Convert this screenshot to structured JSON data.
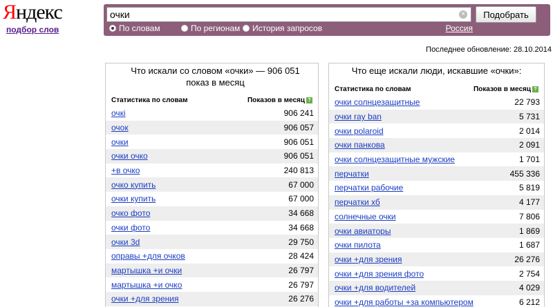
{
  "logo": {
    "brand_first": "Я",
    "brand_rest": "ндекс",
    "sub": "подбор слов"
  },
  "search": {
    "value": "очки",
    "clear_glyph": "×",
    "submit_label": "Подобрать",
    "modes": [
      "По словам",
      "По регионам",
      "История запросов"
    ],
    "active_mode": 0,
    "region": "Россия"
  },
  "updated": "Последнее обновление: 28.10.2014",
  "left": {
    "title": "Что искали со словом «очки» — 906 051 показ в месяц",
    "col_words": "Статистика по словам",
    "col_shows": "Показов в месяц",
    "help": "?",
    "rows": [
      {
        "kw": "очкі",
        "count": "906 241"
      },
      {
        "kw": "очок",
        "count": "906 057"
      },
      {
        "kw": "очки",
        "count": "906 051"
      },
      {
        "kw": "очки очко",
        "count": "906 051"
      },
      {
        "kw": "+в очко",
        "count": "240 813"
      },
      {
        "kw": "очко купить",
        "count": "67 000"
      },
      {
        "kw": "очки купить",
        "count": "67 000"
      },
      {
        "kw": "очко фото",
        "count": "34 668"
      },
      {
        "kw": "очки фото",
        "count": "34 668"
      },
      {
        "kw": "очки 3d",
        "count": "29 750"
      },
      {
        "kw": "оправы +для очков",
        "count": "28 424"
      },
      {
        "kw": "мартышка +и очки",
        "count": "26 797"
      },
      {
        "kw": "мартышка +и очко",
        "count": "26 797"
      },
      {
        "kw": "очки +для зрения",
        "count": "26 276"
      }
    ]
  },
  "right": {
    "title": "Что еще искали люди, искавшие «очки»:",
    "col_words": "Статистика по словам",
    "col_shows": "Показов в месяц",
    "help": "?",
    "rows": [
      {
        "kw": "очки солнцезащитные",
        "count": "22 793"
      },
      {
        "kw": "очки ray ban",
        "count": "5 731"
      },
      {
        "kw": "очки polaroid",
        "count": "2 014"
      },
      {
        "kw": "очки панкова",
        "count": "2 091"
      },
      {
        "kw": "очки солнцезащитные мужские",
        "count": "1 701"
      },
      {
        "kw": "перчатки",
        "count": "455 336"
      },
      {
        "kw": "перчатки рабочие",
        "count": "5 819"
      },
      {
        "kw": "перчатки хб",
        "count": "4 177"
      },
      {
        "kw": "солнечные очки",
        "count": "7 806"
      },
      {
        "kw": "очки авиаторы",
        "count": "1 869"
      },
      {
        "kw": "очки пилота",
        "count": "1 687"
      },
      {
        "kw": "очки +для зрения",
        "count": "26 276"
      },
      {
        "kw": "очки +для зрения фото",
        "count": "2 754"
      },
      {
        "kw": "очки +для водителей",
        "count": "4 029"
      },
      {
        "kw": "очки +для работы +за компьютером",
        "count": "6 212"
      }
    ]
  }
}
